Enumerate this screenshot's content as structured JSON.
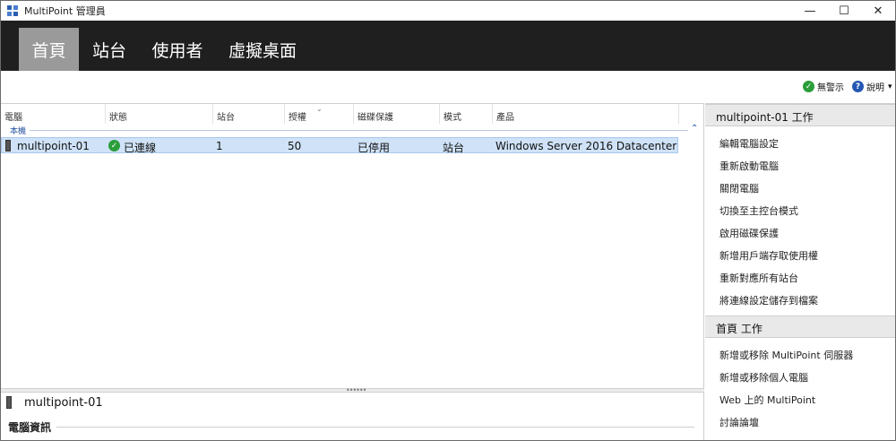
{
  "window": {
    "title": "MultiPoint 管理員",
    "minimize_glyph": "—",
    "maximize_glyph": "☐",
    "close_glyph": "✕"
  },
  "nav": {
    "tabs": [
      {
        "label": "首頁",
        "active": true
      },
      {
        "label": "站台",
        "active": false
      },
      {
        "label": "使用者",
        "active": false
      },
      {
        "label": "虛擬桌面",
        "active": false
      }
    ]
  },
  "help": {
    "no_alerts": "無警示",
    "help_label": "說明",
    "dropdown_glyph": "▾"
  },
  "table": {
    "columns": [
      "電腦",
      "狀態",
      "站台",
      "授權",
      "磁碟保護",
      "模式",
      "產品"
    ],
    "group_label": "本機",
    "collapse_glyph": "⌃",
    "sort_glyph": "⌄",
    "rows": [
      {
        "computer": "multipoint-01",
        "status": "已連線",
        "stations": "1",
        "licenses": "50",
        "disk_protection": "已停用",
        "mode": "站台",
        "product": "Windows Server 2016 Datacenter"
      }
    ]
  },
  "splitter": {
    "grip": "••••••"
  },
  "detail": {
    "title": "multipoint-01",
    "section": "電腦資訊"
  },
  "tasks": {
    "computer_header": "multipoint-01 工作",
    "computer_tasks": [
      "編輯電腦設定",
      "重新啟動電腦",
      "關閉電腦",
      "切換至主控台模式",
      "啟用磁碟保護",
      "新增用戶端存取使用權",
      "重新對應所有站台",
      "將連線設定儲存到檔案"
    ],
    "home_header": "首頁 工作",
    "home_tasks": [
      "新增或移除 MultiPoint 伺服器",
      "新增或移除個人電腦",
      "Web 上的 MultiPoint",
      "討論論壇"
    ]
  },
  "colors": {
    "nav_bg": "#1f1f1f",
    "nav_active": "#9a9a9a",
    "selection": "#cfe2f7",
    "status_ok": "#2a9d3a",
    "help_blue": "#2457b3"
  }
}
